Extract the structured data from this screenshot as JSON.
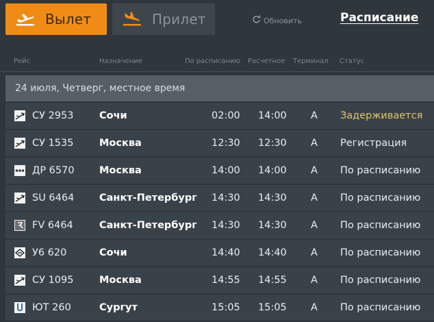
{
  "tabs": {
    "departures_label": "Вылет",
    "arrivals_label": "Прилет"
  },
  "refresh_label": "Обновить",
  "schedule_link": "Расписание",
  "columns": {
    "flight": "Рейс",
    "destination": "Назначение",
    "scheduled": "По расписанию",
    "estimated": "Расчетное",
    "terminal": "Терминал",
    "status": "Статус"
  },
  "date_header": "24 июля, Четверг, местное время",
  "colors": {
    "accent": "#f08c16",
    "delayed": "#e4c36c"
  },
  "flights": [
    {
      "airline_icon": "aeroflot-icon",
      "flight": "СУ 2953",
      "destination": "Сочи",
      "scheduled": "02:00",
      "estimated": "14:00",
      "terminal": "A",
      "status": "Задерживается",
      "delayed": true
    },
    {
      "airline_icon": "aeroflot-icon",
      "flight": "СУ 1535",
      "destination": "Москва",
      "scheduled": "12:30",
      "estimated": "12:30",
      "terminal": "A",
      "status": "Регистрация",
      "delayed": false
    },
    {
      "airline_icon": "donavia-icon",
      "flight": "ДР 6570",
      "destination": "Москва",
      "scheduled": "14:00",
      "estimated": "14:00",
      "terminal": "A",
      "status": "По расписанию",
      "delayed": false
    },
    {
      "airline_icon": "aeroflot-icon",
      "flight": "SU 6464",
      "destination": "Санкт-Петербург",
      "scheduled": "14:30",
      "estimated": "14:30",
      "terminal": "A",
      "status": "По расписанию",
      "delayed": false
    },
    {
      "airline_icon": "rossiya-icon",
      "flight": "FV 6464",
      "destination": "Санкт-Петербург",
      "scheduled": "14:30",
      "estimated": "14:30",
      "terminal": "A",
      "status": "По расписанию",
      "delayed": false
    },
    {
      "airline_icon": "ural-airlines-icon",
      "flight": "У6 620",
      "destination": "Сочи",
      "scheduled": "14:40",
      "estimated": "14:40",
      "terminal": "A",
      "status": "По расписанию",
      "delayed": false
    },
    {
      "airline_icon": "aeroflot-icon",
      "flight": "СУ 1095",
      "destination": "Москва",
      "scheduled": "14:55",
      "estimated": "14:55",
      "terminal": "A",
      "status": "По расписанию",
      "delayed": false
    },
    {
      "airline_icon": "utair-icon",
      "flight": "ЮТ 260",
      "destination": "Сургут",
      "scheduled": "15:05",
      "estimated": "15:05",
      "terminal": "A",
      "status": "По расписанию",
      "delayed": false
    }
  ]
}
